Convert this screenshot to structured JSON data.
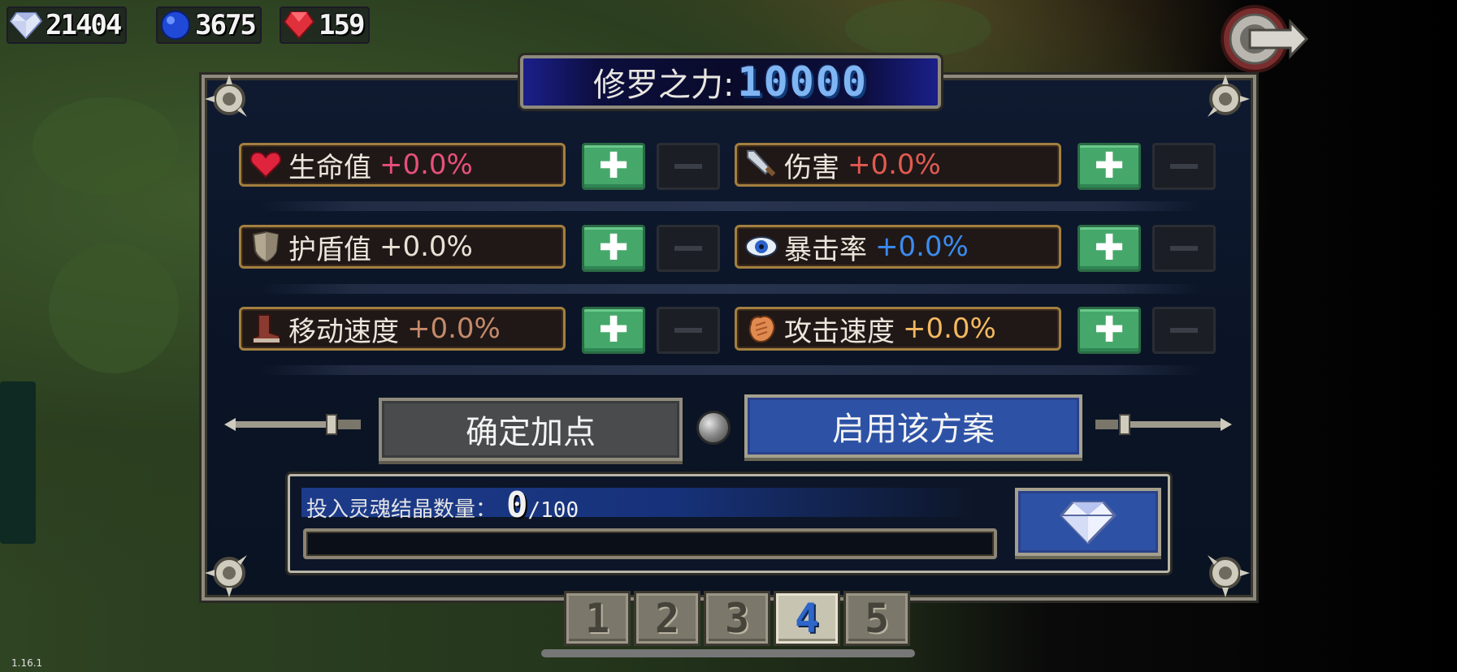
{
  "resources": {
    "diamonds": "21404",
    "sapphires": "3675",
    "rubies": "159"
  },
  "panel": {
    "title_label": "修罗之力:",
    "title_value": "10000"
  },
  "stats": [
    {
      "icon": "heart-icon",
      "name": "生命值",
      "value": "+0.0%",
      "value_color": "#e8507a"
    },
    {
      "icon": "sword-icon",
      "name": "伤害",
      "value": "+0.0%",
      "value_color": "#e25a50"
    },
    {
      "icon": "shield-icon",
      "name": "护盾值",
      "value": "+0.0%",
      "value_color": "#e8e2d6"
    },
    {
      "icon": "eye-icon",
      "name": "暴击率",
      "value": "+0.0%",
      "value_color": "#3a8cf0"
    },
    {
      "icon": "boot-icon",
      "name": "移动速度",
      "value": "+0.0%",
      "value_color": "#c48a6a"
    },
    {
      "icon": "fist-icon",
      "name": "攻击速度",
      "value": "+0.0%",
      "value_color": "#f3b960"
    }
  ],
  "actions": {
    "confirm_label": "确定加点",
    "enable_label": "启用该方案"
  },
  "crystal_input": {
    "label": "投入灵魂结晶数量：",
    "current": "0",
    "max": "/100",
    "progress": 0
  },
  "tabs": [
    {
      "label": "1",
      "active": false
    },
    {
      "label": "2",
      "active": false
    },
    {
      "label": "3",
      "active": false
    },
    {
      "label": "4",
      "active": true
    },
    {
      "label": "5",
      "active": false
    }
  ],
  "version": "1.16.1",
  "colors": {
    "plus_button": "#45a86a",
    "enable_button": "#2d52a5",
    "panel_bg": "#0b1426",
    "title_value": "#7fb5f2"
  }
}
